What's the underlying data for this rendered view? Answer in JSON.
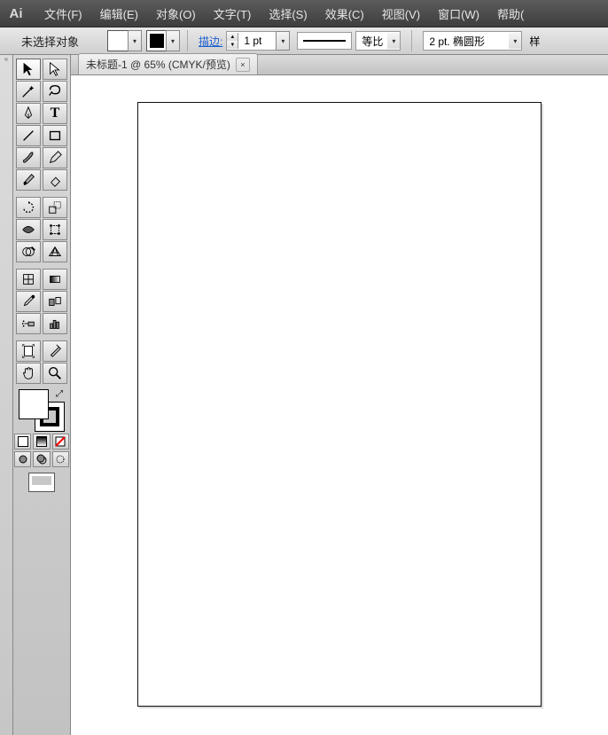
{
  "app": {
    "logo": "Ai"
  },
  "menu": [
    {
      "label": "文件(F)"
    },
    {
      "label": "编辑(E)"
    },
    {
      "label": "对象(O)"
    },
    {
      "label": "文字(T)"
    },
    {
      "label": "选择(S)"
    },
    {
      "label": "效果(C)"
    },
    {
      "label": "视图(V)"
    },
    {
      "label": "窗口(W)"
    },
    {
      "label": "帮助("
    }
  ],
  "control": {
    "selection_status": "未选择对象",
    "stroke_label": "描边:",
    "stroke_weight": "1 pt",
    "scale_label": "等比",
    "brush_label": "2 pt. 椭圆形",
    "style_label_frag": "样"
  },
  "tab": {
    "title": "未标题-1  @  65% (CMYK/预览)",
    "close": "×"
  },
  "tools": {
    "rows": [
      [
        "selection-tool",
        "direct-selection-tool"
      ],
      [
        "magic-wand-tool",
        "lasso-tool"
      ],
      [
        "pen-tool",
        "type-tool"
      ],
      [
        "line-segment-tool",
        "rectangle-tool"
      ],
      [
        "paintbrush-tool",
        "pencil-tool"
      ],
      [
        "blob-brush-tool",
        "eraser-tool"
      ],
      [
        "rotate-tool",
        "scale-tool"
      ],
      [
        "width-tool",
        "free-transform-tool"
      ],
      [
        "shape-builder-tool",
        "perspective-grid-tool"
      ],
      [
        "mesh-tool",
        "gradient-tool"
      ],
      [
        "eyedropper-tool",
        "blend-tool"
      ],
      [
        "symbol-sprayer-tool",
        "column-graph-tool"
      ],
      [
        "artboard-tool",
        "slice-tool"
      ],
      [
        "hand-tool",
        "zoom-tool"
      ]
    ],
    "color_modes": [
      "normal-color",
      "gradient-color",
      "none-color"
    ],
    "draw_modes": [
      "draw-normal",
      "draw-behind",
      "draw-inside"
    ]
  }
}
